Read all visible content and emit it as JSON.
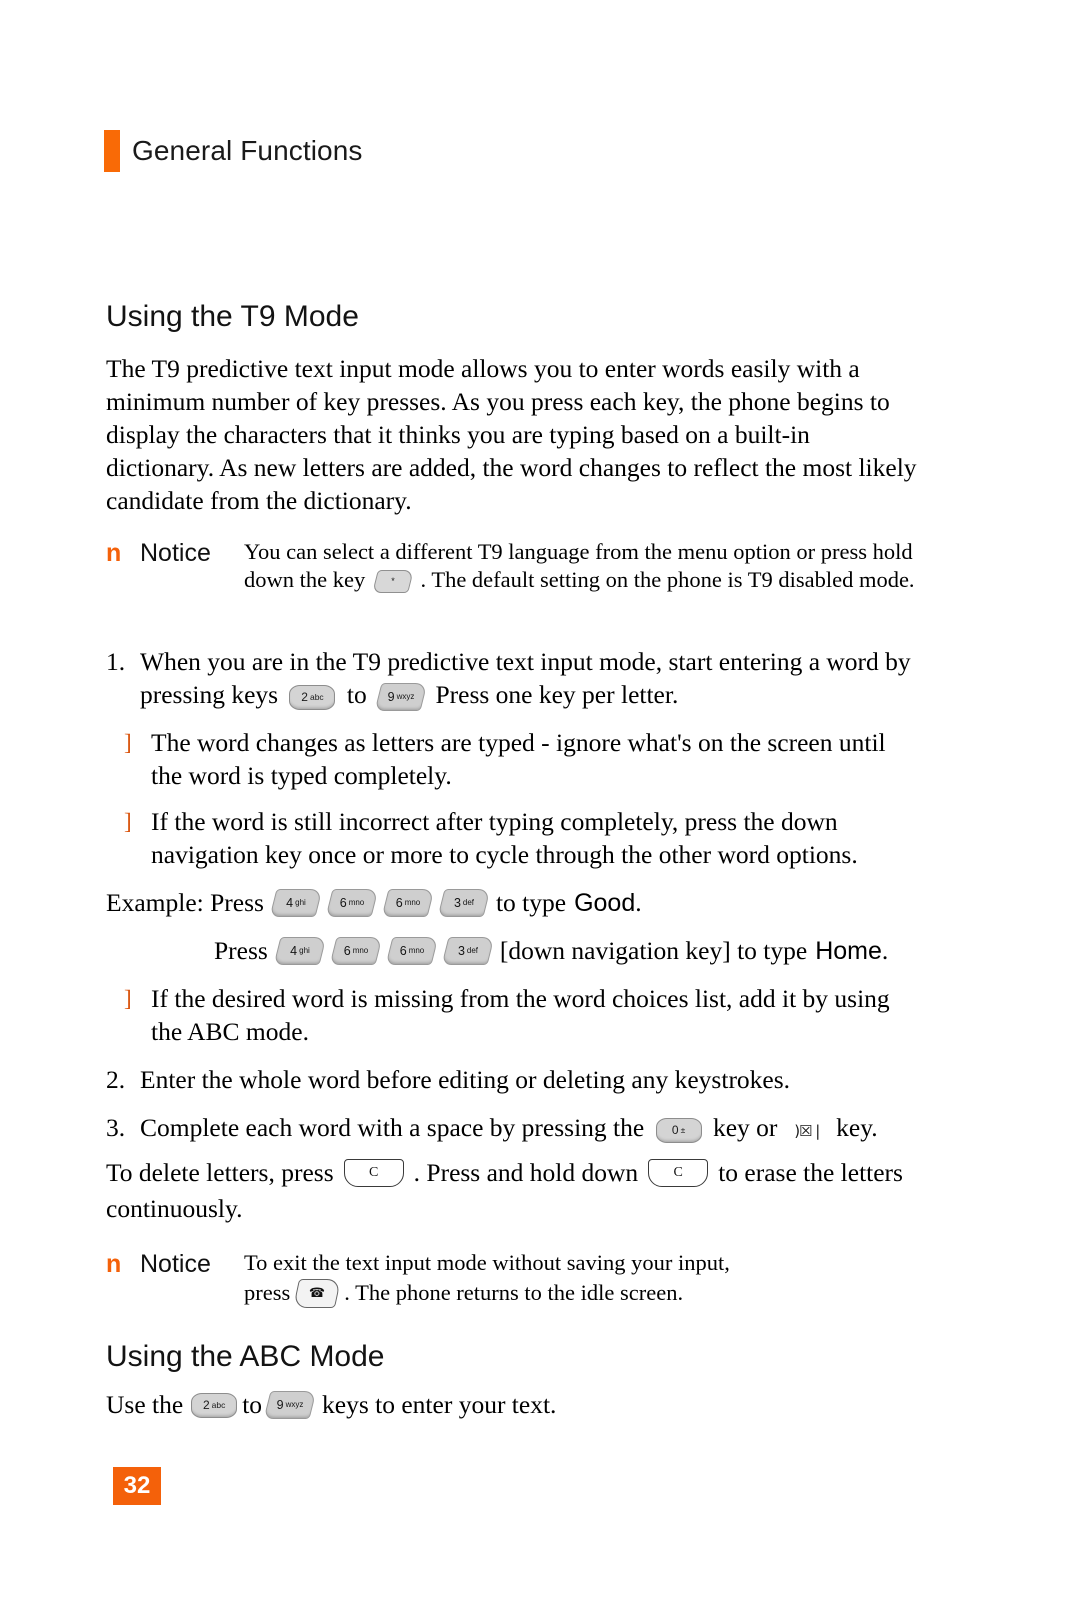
{
  "header": {
    "title": "General Functions",
    "accent_color": "#f96a06"
  },
  "sections": {
    "t9_heading": "Using the T9 Mode",
    "t9_intro": "The T9 predictive text input mode allows you to enter words easily with a minimum number of key presses. As you press each key, the phone begins to display the characters that it thinks you are typing based on a built-in dictionary. As new letters are added, the word changes to reflect the most likely candidate from the dictionary.",
    "abc_heading": "Using the ABC Mode"
  },
  "notice_top": {
    "marker": "n",
    "label": "Notice",
    "text_before_key": "You can select a different T9 language from the menu option or press hold down the key",
    "text_after_key": ". The default setting on the phone is T9 disabled mode.",
    "key_icon": "star-key-icon",
    "key_main": "*",
    "key_sub": "❀"
  },
  "steps": [
    {
      "marker": "1.",
      "text_a": "When you are in the T9 predictive text input mode, start entering a word by pressing keys",
      "key1_main": "2",
      "key1_sub": "abc",
      "mid": "to",
      "key2_main": "9",
      "key2_sub": "wxyz",
      "text_b": "Press one key per letter."
    },
    {
      "marker": "2.",
      "text_a": "Enter the whole word before editing or deleting any keystrokes."
    },
    {
      "marker": "3.",
      "text_a": "Complete each word with a space by pressing the",
      "key1_main": "0",
      "key1_sub": "±",
      "mid": "key or",
      "key2_glyph": ")☒ |",
      "text_b": "key."
    }
  ],
  "bullets": [
    "The word changes as letters are typed - ignore what's on the screen until the word is typed completely.",
    "If the word is still incorrect after typing completely, press the down navigation key once or more to cycle through the other word options.",
    "If the desired word is missing from the word choices list, add it by using the ABC mode."
  ],
  "bullet_marker": "]",
  "example": {
    "line1_lead": "Example: Press",
    "line1_tail": "to type",
    "line1_word": "Good",
    "line1_period": ".",
    "line2_lead": "Press",
    "line2_mid": "[down navigation key] to type",
    "line2_word": "Home",
    "line2_period": ".",
    "keys": [
      {
        "main": "4",
        "sub": "ghi"
      },
      {
        "main": "6",
        "sub": "mno"
      },
      {
        "main": "6",
        "sub": "mno"
      },
      {
        "main": "3",
        "sub": "def"
      }
    ]
  },
  "delete_para": {
    "lead": "To delete letters, press",
    "key1": "C",
    "mid": ". Press and hold down",
    "key2": "C",
    "tail": "to erase the letters",
    "line2": "continuously."
  },
  "notice_bottom": {
    "marker": "n",
    "label": "Notice",
    "text_line1": "To exit the text input mode without saving your input,",
    "text_line2_lead": "press",
    "key_glyph": "☎",
    "text_line2_tail": ". The phone returns to the idle screen."
  },
  "abc_para": {
    "lead": "Use the",
    "key1_main": "2",
    "key1_sub": "abc",
    "mid": "to",
    "key2_main": "9",
    "key2_sub": "wxyz",
    "tail": "keys to enter your text."
  },
  "page_number": "32"
}
